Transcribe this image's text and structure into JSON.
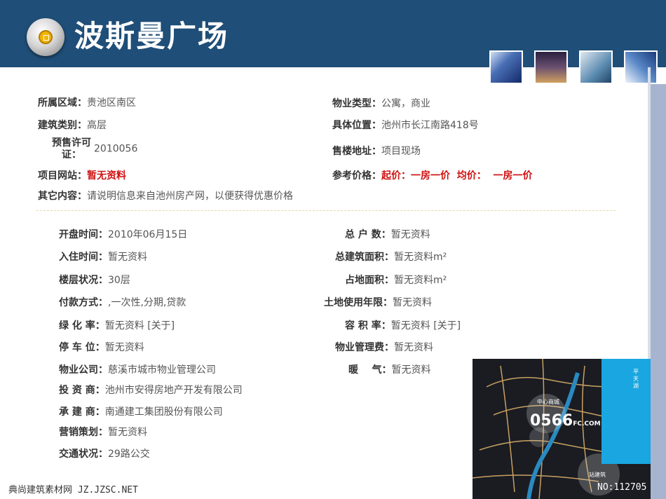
{
  "header": {
    "title": "波斯曼广场"
  },
  "info": [
    {
      "label": "所属区域：",
      "value": "贵池区南区"
    },
    {
      "label": "建筑类别：",
      "value": "高层"
    },
    {
      "label": "预售许可",
      "label2": "证：",
      "value": "2010056"
    },
    {
      "label": "项目网站：",
      "value": "暂无资料"
    },
    {
      "label": "其它内容：",
      "value": "请说明信息来自池州房产网，以便获得优惠价格"
    },
    {
      "label": "物业类型：",
      "value": "公寓，商业"
    },
    {
      "label": "具体位置：",
      "value": "池州市长江南路418号"
    },
    {
      "label": "售楼地址：",
      "value": "项目现场"
    },
    {
      "label": "参考价格：",
      "value": "起价：一房一价  均价：  一房一价"
    }
  ],
  "details_left": [
    {
      "label": "开盘时间：",
      "value": "2010年06月15日"
    },
    {
      "label": "入住时间：",
      "value": "暂无资料"
    },
    {
      "label": "楼层状况：",
      "value": "30层"
    },
    {
      "label": "付款方式：",
      "value": ",一次性,分期,贷款"
    },
    {
      "label": "绿 化 率：",
      "value": "暂无资料 [关于]"
    },
    {
      "label": "停 车 位：",
      "value": "暂无资料"
    },
    {
      "label": "物业公司：",
      "value": "慈溪市城市物业管理公司"
    },
    {
      "label": "投 资 商：",
      "value": "池州市安得房地产开发有限公司"
    },
    {
      "label": "承 建 商：",
      "value": "南通建工集团股份有限公司"
    },
    {
      "label": "营销策划：",
      "value": "暂无资料"
    },
    {
      "label": "交通状况：",
      "value": "29路公交"
    }
  ],
  "details_right": [
    {
      "label": "总 户 数：",
      "value": "暂无资料"
    },
    {
      "label": "总建筑面积：",
      "value": "暂无资料m²"
    },
    {
      "label": "占地面积：",
      "value": "暂无资料m²"
    },
    {
      "label": "土地使用年限：",
      "value": "暂无资料"
    },
    {
      "label": "容 积 率：",
      "value": "暂无资料 [关于]"
    },
    {
      "label": "物业管理费：",
      "value": "暂无资料"
    },
    {
      "label": "暖    气：",
      "value": "暂无资料"
    }
  ],
  "map": {
    "brand": "0566",
    "brand_sub": "FC.COM",
    "no_label": "NO:112705",
    "place_top": "中心商城",
    "place_right": "平天湖",
    "place_bottom": "站建筑"
  },
  "footer": {
    "watermark": "典尚建筑素材网 JZ.JZSC.NET"
  },
  "colors": {
    "header": "#1f4e78",
    "accent_red": "#d01010",
    "sidebar": "#a7b4cf"
  }
}
